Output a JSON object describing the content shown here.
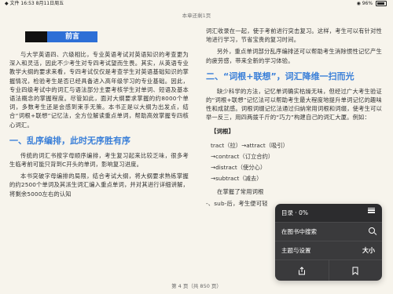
{
  "status": {
    "left": "◆ 文件  16:53  8月11日周五",
    "right": "◉ 96%",
    "battery_level": 0.96
  },
  "header": {
    "title": "本章还剩1页"
  },
  "left_page": {
    "preface": "前言",
    "paragraph1": "与大学英语四、六级相比，专业英语考试对英语知识的考查更为深入和灵活，因此不少考生对专四考试望而生畏。其实，从英语专业教学大纲的要求来看，专四考试仅仅是考查学生对英语基础知识的掌握情况，检验考生是否已经具备进入高年级学习的专业基础。因此，专业四级考试中的词汇与语法部分主要考核学生对单词、短语及基本语法概念的掌握程度。尽管如此，面对大纲要求掌握的约8000个单词，多数考生还是会感到束手无策。本书正是以大纲为出发点，结合“词根+联想”记忆法，全方位解读重点单词，帮助高效掌握专四核心词汇。",
    "h_section1": "一、乱序编排，此时无序胜有序",
    "paragraph2": "传统的词汇书按字母顺序编排，考生复习起来比较乏味，很多考生临考前可能只背到C开头的单词，影响复习进度。",
    "paragraph3": "本书突破字母编排的局限，结合考试大纲，将大纲要求熟练掌握的约2500个单词及其派生词汇编入重点单词，并对其进行详细讲解，将剩余5000左右的认知"
  },
  "right_page": {
    "paragraph_cont": "词汇收录在一起，使于考前进行突击复习。这样，考生可以有针对性地进行学习，节省宝贵的复习时间。",
    "paragraph_2": "另外，重点单词部分乱序编排还可以帮助考生消除惯性记忆产生的疲劳感，带来全新的学习体验。",
    "h_section2": "二、“词根+联想”，词汇降维一扫而光",
    "paragraph_3": "缺少科学的方法，记忆单词确实枯燥无味，但经过广大考生验证的“词根+联想”记忆法可以帮助考生最大程度地提升单词记忆的趣味性和成就感。词根词缀记忆法通过归纳常用词根和词缀，使考生可以举一反三，用四两拨千斤的“巧力”构建自己的词汇大厦。例如：",
    "keyword_title": "【词根】",
    "kw1": "tract（拉）→attract（吸引）",
    "kw2": "→contract（订立合约）",
    "kw3": "→distract（使分心）",
    "kw4": "→subtract（减去）",
    "paragraph_4": "在掌握了常用词根",
    "paragraph_5": "-、sub-后，考生便可轻"
  },
  "footer": {
    "page_info": "第 4 页（共 850 页）"
  },
  "menu": {
    "toc_label": "目录 · 0%",
    "search_label": "在图书中搜索",
    "theme_label": "主题与设置",
    "theme_icon_text": "大小",
    "share_icon": "share-icon",
    "bookmark_icon": "bookmark-icon"
  }
}
